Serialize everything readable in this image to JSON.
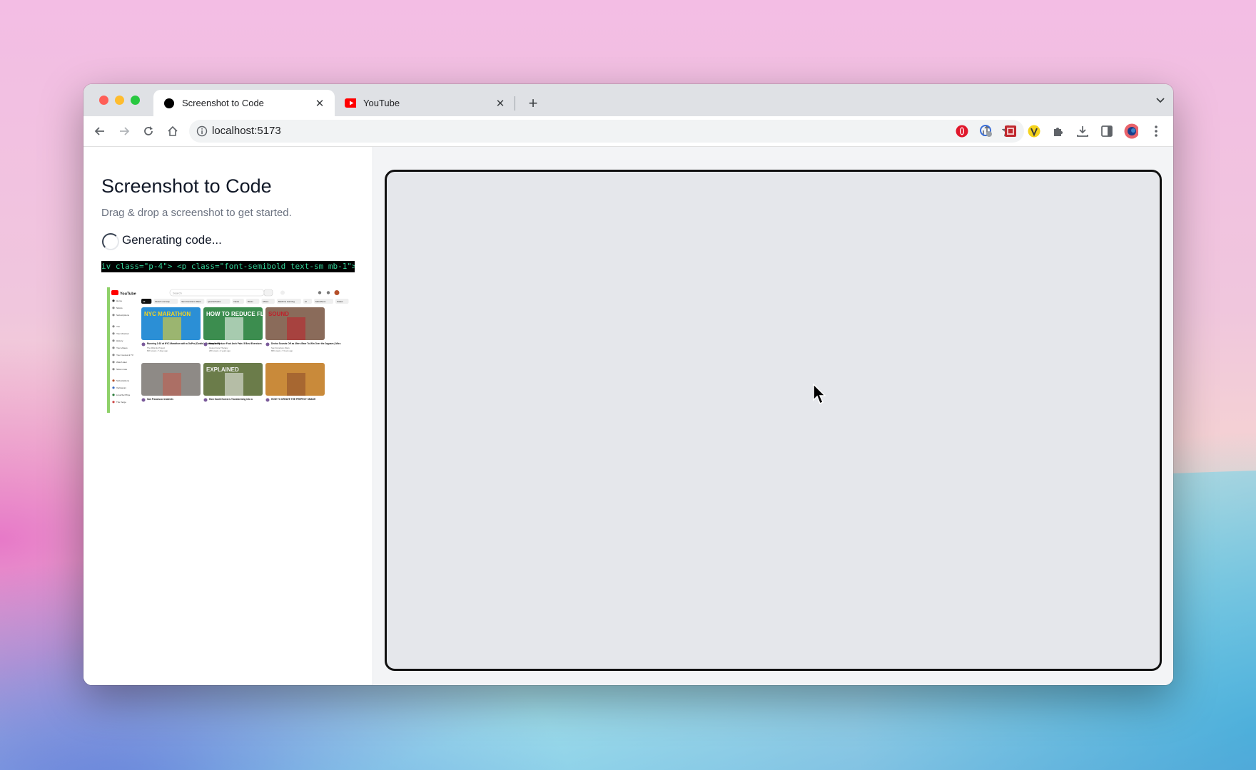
{
  "window": {
    "controls": {
      "close_color": "#ff5f57",
      "minimize_color": "#febc2e",
      "maximize_color": "#28c840"
    }
  },
  "tabs": [
    {
      "title": "Screenshot to Code",
      "favicon": "black-circle-icon",
      "active": true
    },
    {
      "title": "YouTube",
      "favicon": "youtube-icon",
      "active": false
    }
  ],
  "addressbar": {
    "url": "localhost:5173"
  },
  "app": {
    "title": "Screenshot to Code",
    "subtitle": "Drag & drop a screenshot to get started.",
    "status": "Generating code...",
    "code_stream": "iv class=\"p-4\"> <p class=\"font-semibold text-sm mb-1\">"
  },
  "thumbnail": {
    "logo": "YouTube",
    "search_placeholder": "Search",
    "chips": [
      "All",
      "Sketch comedy",
      "San Francisco 49ers",
      "Quarterbacks",
      "News",
      "Music",
      "Mixes",
      "Machine learning",
      "AI",
      "Marathons",
      "Cakes",
      "Gaming"
    ],
    "sidebar_items": [
      "Home",
      "Shorts",
      "Subscriptions",
      "You",
      "Your channel",
      "History",
      "Your videos",
      "Your movies & TV",
      "Watch later",
      "Show more",
      "Subscriptions",
      "Veritasium",
      "LinusTechTips",
      "The Verge"
    ],
    "videos": [
      {
        "overlay": "NYC MARATHON",
        "title": "Running 2:33 at NYC Marathon with a GoPro (Dustin's Atmosphere)",
        "meta": "The Ridiculo Project",
        "stats": "82K views • 7 days ago",
        "thumb_color": "#2b8fd6",
        "accent": "#f7d51d"
      },
      {
        "overlay": "HOW TO REDUCE FLAT",
        "title": "How to Reduce Foot Arch Pain: 5 Best Exercises",
        "meta": "Injured Care Therapy",
        "stats": "29K views • 2 years ago",
        "thumb_color": "#3c8d4f",
        "accent": "#ffffff"
      },
      {
        "overlay": "SOUND",
        "title": "Deebo Sounds Off as 49ers Bear To Win Over the Jaguars | Mics",
        "meta": "San Francisco 49ers",
        "stats": "86K views • 7 hours ago",
        "thumb_color": "#8a6b5a",
        "accent": "#c0202a"
      },
      {
        "overlay": "",
        "title": "San Francisco residents",
        "meta": "",
        "stats": "",
        "thumb_color": "#8e8a86",
        "accent": "#c45a4a"
      },
      {
        "overlay": "EXPLAINED",
        "title": "How South Korea is Transforming into a",
        "meta": "",
        "stats": "",
        "thumb_color": "#6b7c4a",
        "accent": "#f2f2f2"
      },
      {
        "overlay": "",
        "title": "HOW TO CREATE THE PERFECT SMASH",
        "meta": "",
        "stats": "",
        "thumb_color": "#c98a3a",
        "accent": "#8b4a2a"
      }
    ]
  }
}
